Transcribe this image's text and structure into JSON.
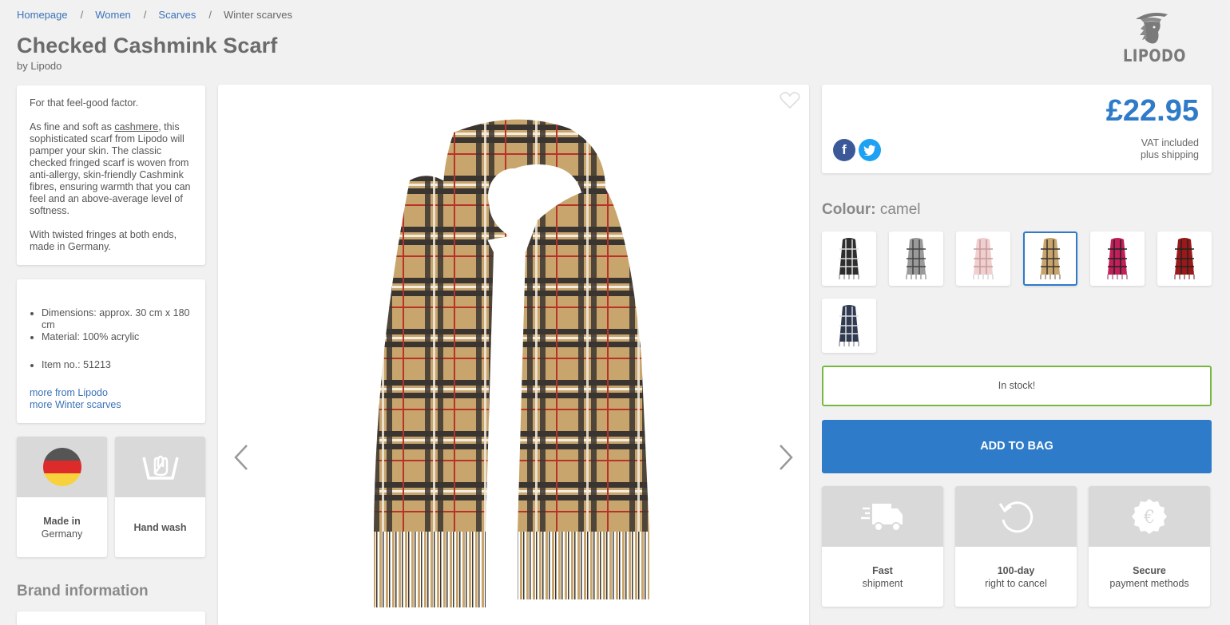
{
  "breadcrumb": {
    "items": [
      "Homepage",
      "Women",
      "Scarves"
    ],
    "separator": "/",
    "current": "Winter scarves"
  },
  "product": {
    "title": "Checked Cashmink Scarf",
    "byline": "by Lipodo"
  },
  "brand": {
    "logo_text": "LIPODO"
  },
  "description": {
    "p1": "For that feel-good factor.",
    "p2_before": "As fine and soft as ",
    "p2_link": "cashmere",
    "p2_after": ", this sophisticated scarf from Lipodo will pamper your skin. The classic checked fringed scarf is woven from anti-allergy, skin-friendly Cashmink fibres, ensuring warmth that you can feel and an above-average level of softness.",
    "p3": "With twisted fringes at both ends, made in Germany."
  },
  "specs": {
    "dimensions": "Dimensions: approx. 30 cm x 180 cm",
    "material": "Material: 100% acrylic",
    "item_no": "Item no.: 51213",
    "link_brand": "more from Lipodo",
    "link_category": "more Winter scarves"
  },
  "features_left": [
    {
      "bold": "Made in",
      "text": "Germany",
      "icon": "germany-flag-icon"
    },
    {
      "bold": "",
      "text": "Hand wash",
      "icon": "hand-wash-icon"
    }
  ],
  "brand_info_heading": "Brand information",
  "price": {
    "amount": "£22.95",
    "vat": "VAT included",
    "shipping": "plus shipping"
  },
  "colour": {
    "label": "Colour:",
    "value": "camel",
    "swatches": [
      "black",
      "grey",
      "pink",
      "camel",
      "fuchsia",
      "red",
      "navy"
    ],
    "selected": "camel"
  },
  "stock": "In stock!",
  "add_to_bag": "ADD TO BAG",
  "features_right": [
    {
      "bold": "Fast",
      "text": "shipment",
      "icon": "truck-icon"
    },
    {
      "bold": "100-day",
      "text": "right to cancel",
      "icon": "return-arrow-icon"
    },
    {
      "bold": "Secure",
      "text": "payment methods",
      "icon": "euro-seal-icon"
    }
  ],
  "colors": {
    "accent_blue": "#2e7bc9",
    "link_blue": "#3b73b9",
    "stock_green": "#77b843",
    "background": "#f1f1f1"
  }
}
